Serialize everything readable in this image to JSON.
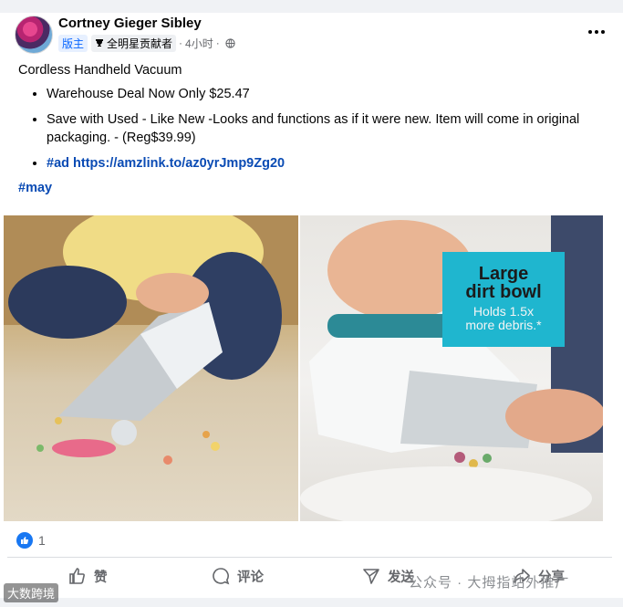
{
  "author": {
    "name": "Cortney Gieger Sibley",
    "role_badge": "版主",
    "star_badge": "全明星贡献者",
    "time": "4小时"
  },
  "post": {
    "title": "Cordless Handheld Vacuum",
    "bullets": [
      "Warehouse Deal Now Only $25.47",
      "Save with Used - Like New -Looks and functions as if it were new. Item will come in original packaging. - (Reg$39.99)"
    ],
    "link_tag": "#ad",
    "link_url": "https://amzlink.to/az0yrJmp9Zg20",
    "hashtag": "#may"
  },
  "photo_right_overlay": {
    "line1": "Large",
    "line2": "dirt bowl",
    "line3": "Holds 1.5x",
    "line4": "more debris.*"
  },
  "reactions": {
    "count": "1"
  },
  "actions": {
    "like": "赞",
    "comment": "评论",
    "send": "发送",
    "share": "分享"
  },
  "watermarks": {
    "left": "大数跨境",
    "right": "公众号 · 大拇指站外推广"
  },
  "colors": {
    "link": "#0a4bb4",
    "facebook_blue": "#1877f2",
    "overlay_cyan": "#1fb6cf"
  }
}
